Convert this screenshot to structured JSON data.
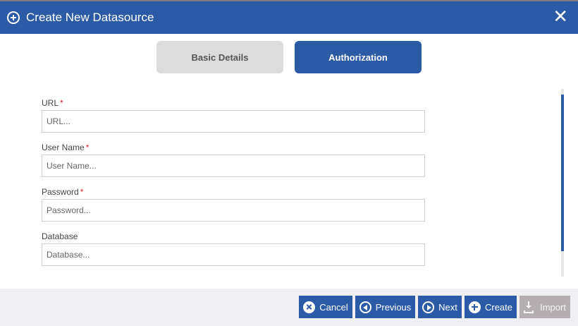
{
  "dialog": {
    "title": "Create New Datasource",
    "title_icon": "plus-circle-icon",
    "close_icon": "close-icon",
    "close_glyph": "✕"
  },
  "tabs": [
    {
      "label": "Basic Details",
      "active": false
    },
    {
      "label": "Authorization",
      "active": true
    }
  ],
  "form": {
    "required_marker": "*",
    "fields": [
      {
        "label": "URL",
        "placeholder": "URL...",
        "value": "",
        "required": true
      },
      {
        "label": "User Name",
        "placeholder": "User Name...",
        "value": "",
        "required": true
      },
      {
        "label": "Password",
        "placeholder": "Password...",
        "value": "",
        "required": true
      },
      {
        "label": "Database",
        "placeholder": "Database...",
        "value": "",
        "required": false
      }
    ]
  },
  "footer": {
    "cancel_label": "Cancel",
    "previous_label": "Previous",
    "next_label": "Next",
    "create_label": "Create",
    "import_label": "Import"
  },
  "colors": {
    "primary": "#2b5ba6",
    "inactive_tab": "#dcdcdc",
    "disabled_button": "#b5aeb0",
    "required": "#d9232d"
  }
}
